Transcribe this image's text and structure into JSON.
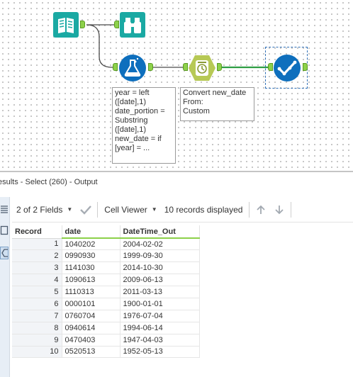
{
  "workflow": {
    "annotations": {
      "formula": "year = left\n([date],1)\ndate_portion =\nSubstring\n([date],1)\nnew_date = if\n[year] = ...",
      "datetime": "Convert new_date\nFrom:\nCustom"
    },
    "colors": {
      "input_tool": "#1aa9a3",
      "browse_tool": "#1aa9a3",
      "formula_tool": "#0e6fbd",
      "datetime_tool": "#b7c955",
      "select_tool": "#0e6fbd",
      "anchor": "#8dd14a",
      "connection": "#555555"
    }
  },
  "results": {
    "title": "esults - Select (260) - Output",
    "toolbar": {
      "fields_label": "2 of 2 Fields",
      "viewer_label": "Cell Viewer",
      "records_label": "10 records displayed"
    },
    "columns": [
      "Record",
      "date",
      "DateTime_Out"
    ],
    "rows": [
      [
        "1",
        "1040202",
        "2004-02-02"
      ],
      [
        "2",
        "0990930",
        "1999-09-30"
      ],
      [
        "3",
        "1141030",
        "2014-10-30"
      ],
      [
        "4",
        "1090613",
        "2009-06-13"
      ],
      [
        "5",
        "1110313",
        "2011-03-13"
      ],
      [
        "6",
        "0000101",
        "1900-01-01"
      ],
      [
        "7",
        "0760704",
        "1976-07-04"
      ],
      [
        "8",
        "0940614",
        "1994-06-14"
      ],
      [
        "9",
        "0470403",
        "1947-04-03"
      ],
      [
        "10",
        "0520513",
        "1952-05-13"
      ]
    ]
  }
}
